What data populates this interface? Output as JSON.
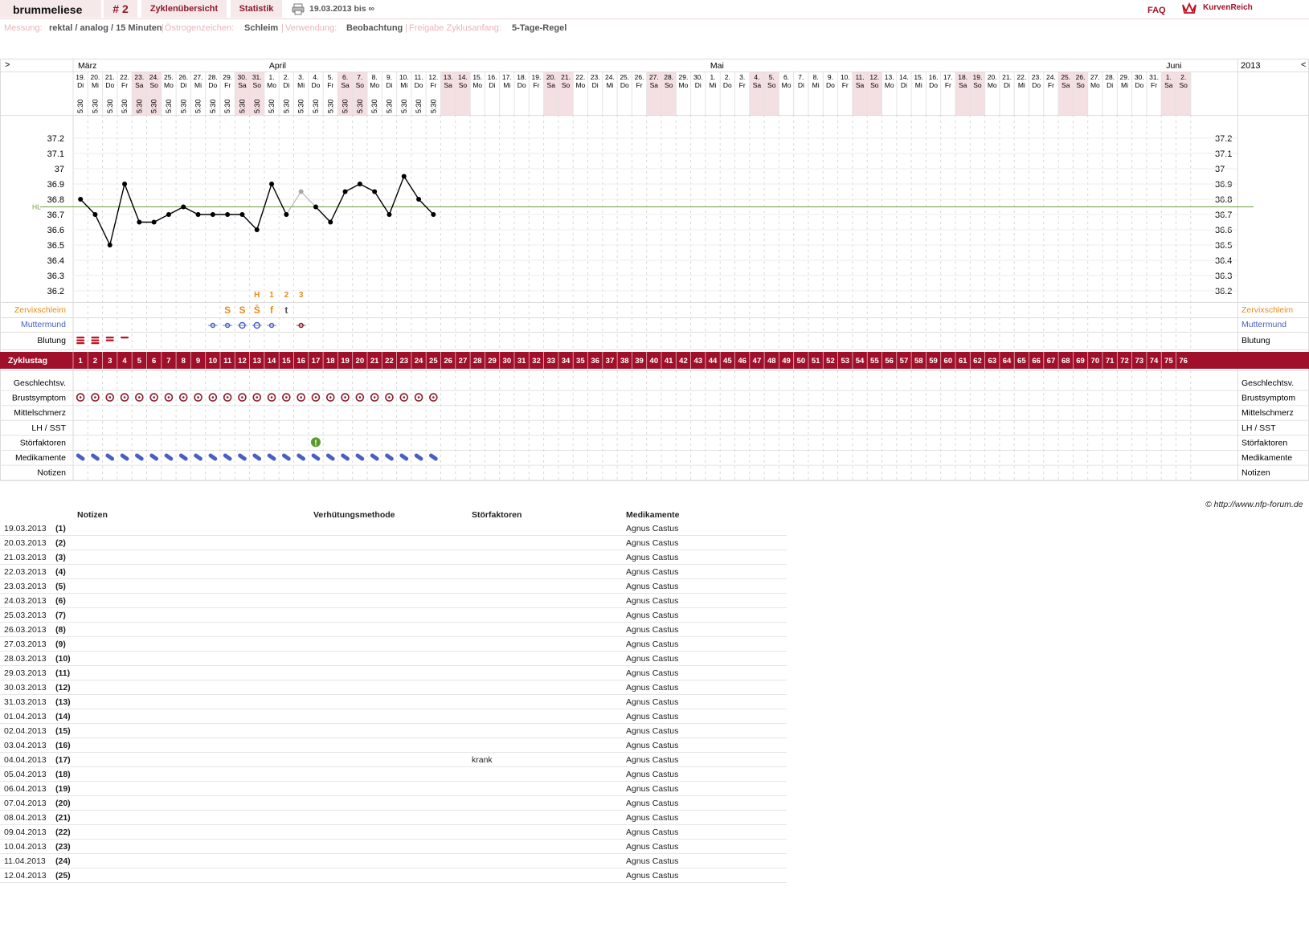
{
  "header": {
    "title": "brummeliese",
    "cycle_number": "# 2",
    "tab_overview": "Zyklenübersicht",
    "tab_stats": "Statistik",
    "date_range": "19.03.2013 bis ∞",
    "faq": "FAQ",
    "logo_text": "KurvenReich"
  },
  "settings": [
    {
      "key": "Messung:",
      "value": "rektal / analog / 15 Minuten"
    },
    {
      "key": "Östrogenzeichen:",
      "value": "Schleim"
    },
    {
      "key": "Verwendung:",
      "value": "Beobachtung"
    },
    {
      "key": "Freigabe Zyklusanfang:",
      "value": "5-Tage-Regel"
    }
  ],
  "nav": {
    "prev": ">",
    "next": "<",
    "year": "2013"
  },
  "months": [
    {
      "label": "März",
      "day_index": 0
    },
    {
      "label": "April",
      "day_index": 13
    },
    {
      "label": "Mai",
      "day_index": 43
    },
    {
      "label": "Juni",
      "day_index": 74
    }
  ],
  "days": [
    [
      "19.",
      "Di"
    ],
    [
      "20.",
      "Mi"
    ],
    [
      "21.",
      "Do"
    ],
    [
      "22.",
      "Fr"
    ],
    [
      "23.",
      "Sa"
    ],
    [
      "24.",
      "So"
    ],
    [
      "25.",
      "Mo"
    ],
    [
      "26.",
      "Di"
    ],
    [
      "27.",
      "Mi"
    ],
    [
      "28.",
      "Do"
    ],
    [
      "29.",
      "Fr"
    ],
    [
      "30.",
      "Sa"
    ],
    [
      "31.",
      "So"
    ],
    [
      "1.",
      "Mo"
    ],
    [
      "2.",
      "Di"
    ],
    [
      "3.",
      "Mi"
    ],
    [
      "4.",
      "Do"
    ],
    [
      "5.",
      "Fr"
    ],
    [
      "6.",
      "Sa"
    ],
    [
      "7.",
      "So"
    ],
    [
      "8.",
      "Mo"
    ],
    [
      "9.",
      "Di"
    ],
    [
      "10.",
      "Mi"
    ],
    [
      "11.",
      "Do"
    ],
    [
      "12.",
      "Fr"
    ],
    [
      "13.",
      "Sa"
    ],
    [
      "14.",
      "So"
    ],
    [
      "15.",
      "Mo"
    ],
    [
      "16.",
      "Di"
    ],
    [
      "17.",
      "Mi"
    ],
    [
      "18.",
      "Do"
    ],
    [
      "19.",
      "Fr"
    ],
    [
      "20.",
      "Sa"
    ],
    [
      "21.",
      "So"
    ],
    [
      "22.",
      "Mo"
    ],
    [
      "23.",
      "Di"
    ],
    [
      "24.",
      "Mi"
    ],
    [
      "25.",
      "Do"
    ],
    [
      "26.",
      "Fr"
    ],
    [
      "27.",
      "Sa"
    ],
    [
      "28.",
      "So"
    ],
    [
      "29.",
      "Mo"
    ],
    [
      "30.",
      "Di"
    ],
    [
      "1.",
      "Mi"
    ],
    [
      "2.",
      "Do"
    ],
    [
      "3.",
      "Fr"
    ],
    [
      "4.",
      "Sa"
    ],
    [
      "5.",
      "So"
    ],
    [
      "6.",
      "Mo"
    ],
    [
      "7.",
      "Di"
    ],
    [
      "8.",
      "Mi"
    ],
    [
      "9.",
      "Do"
    ],
    [
      "10.",
      "Fr"
    ],
    [
      "11.",
      "Sa"
    ],
    [
      "12.",
      "So"
    ],
    [
      "13.",
      "Mo"
    ],
    [
      "14.",
      "Di"
    ],
    [
      "15.",
      "Mi"
    ],
    [
      "16.",
      "Do"
    ],
    [
      "17.",
      "Fr"
    ],
    [
      "18.",
      "Sa"
    ],
    [
      "19.",
      "So"
    ],
    [
      "20.",
      "Mo"
    ],
    [
      "21.",
      "Di"
    ],
    [
      "22.",
      "Mi"
    ],
    [
      "23.",
      "Do"
    ],
    [
      "24.",
      "Fr"
    ],
    [
      "25.",
      "Sa"
    ],
    [
      "26.",
      "So"
    ],
    [
      "27.",
      "Mo"
    ],
    [
      "28.",
      "Di"
    ],
    [
      "29.",
      "Mi"
    ],
    [
      "30.",
      "Do"
    ],
    [
      "31.",
      "Fr"
    ],
    [
      "1.",
      "Sa"
    ],
    [
      "2.",
      "So"
    ]
  ],
  "weekend_indices": [
    4,
    5,
    11,
    12,
    18,
    19,
    25,
    26,
    32,
    33,
    39,
    40,
    46,
    47,
    53,
    54,
    60,
    61,
    67,
    68,
    74,
    75
  ],
  "measure_time": "5:30",
  "measured_days": 25,
  "y_ticks": [
    "37.2",
    "37.1",
    "37",
    "36.9",
    "36.8",
    "36.7",
    "36.6",
    "36.5",
    "36.4",
    "36.3",
    "36.2"
  ],
  "hl_label": "HL",
  "chart_data": {
    "type": "line",
    "ylim": [
      36.1,
      37.3
    ],
    "coverline": 36.75,
    "values": [
      36.8,
      36.7,
      36.5,
      36.9,
      36.65,
      36.65,
      36.7,
      36.75,
      36.7,
      36.7,
      36.7,
      36.7,
      36.6,
      36.9,
      36.7,
      36.85,
      36.75,
      36.65,
      36.85,
      36.9,
      36.85,
      36.7,
      36.95,
      36.8,
      36.7
    ],
    "excluded_indices": [
      15
    ]
  },
  "peak_markers": [
    {
      "day": 12,
      "label": "H"
    },
    {
      "day": 13,
      "label": "1"
    },
    {
      "day": 14,
      "label": "2"
    },
    {
      "day": 15,
      "label": "3"
    }
  ],
  "mucus": [
    {
      "day": 10,
      "label": "S"
    },
    {
      "day": 11,
      "label": "S"
    },
    {
      "day": 12,
      "label": "S̄"
    },
    {
      "day": 13,
      "label": "f"
    },
    {
      "day": 14,
      "label": "t"
    }
  ],
  "cervix_days": [
    9,
    10,
    11,
    12,
    13,
    15
  ],
  "bleeding": [
    3,
    3,
    2,
    1
  ],
  "row_labels_top": {
    "zervix": "Zervixschleim",
    "muttermund": "Muttermund",
    "blutung": "Blutung"
  },
  "cycle_day_label": "Zyklustag",
  "cycle_days": [
    "1",
    "2",
    "3",
    "4",
    "5",
    "6",
    "7",
    "8",
    "9",
    "10",
    "11",
    "12",
    "13",
    "14",
    "15",
    "16",
    "17",
    "18",
    "19",
    "20",
    "21",
    "22",
    "23",
    "24",
    "25",
    "26",
    "27",
    "28",
    "29",
    "30",
    "31",
    "32",
    "33",
    "34",
    "35",
    "36",
    "37",
    "38",
    "39",
    "40",
    "41",
    "42",
    "43",
    "44",
    "45",
    "46",
    "47",
    "48",
    "49",
    "50",
    "51",
    "52",
    "53",
    "54",
    "55",
    "56",
    "57",
    "58",
    "59",
    "60",
    "61",
    "62",
    "63",
    "64",
    "65",
    "66",
    "67",
    "68",
    "69",
    "70",
    "71",
    "72",
    "73",
    "74",
    "75",
    "76"
  ],
  "row_labels_bottom": [
    "Geschlechtsv.",
    "Brustsymptom",
    "Mittelschmerz",
    "LH / SST",
    "Störfaktoren",
    "Medikamente",
    "Notizen"
  ],
  "stoerfaktor_day": 16,
  "copyright": "© http://www.nfp-forum.de",
  "notes_table": {
    "headers": [
      "Notizen",
      "Verhütungsmethode",
      "Störfaktoren",
      "Medikamente"
    ],
    "rows": [
      {
        "date": "19.03.2013",
        "day": "(1)",
        "stoer": "",
        "med": "Agnus Castus"
      },
      {
        "date": "20.03.2013",
        "day": "(2)",
        "stoer": "",
        "med": "Agnus Castus"
      },
      {
        "date": "21.03.2013",
        "day": "(3)",
        "stoer": "",
        "med": "Agnus Castus"
      },
      {
        "date": "22.03.2013",
        "day": "(4)",
        "stoer": "",
        "med": "Agnus Castus"
      },
      {
        "date": "23.03.2013",
        "day": "(5)",
        "stoer": "",
        "med": "Agnus Castus"
      },
      {
        "date": "24.03.2013",
        "day": "(6)",
        "stoer": "",
        "med": "Agnus Castus"
      },
      {
        "date": "25.03.2013",
        "day": "(7)",
        "stoer": "",
        "med": "Agnus Castus"
      },
      {
        "date": "26.03.2013",
        "day": "(8)",
        "stoer": "",
        "med": "Agnus Castus"
      },
      {
        "date": "27.03.2013",
        "day": "(9)",
        "stoer": "",
        "med": "Agnus Castus"
      },
      {
        "date": "28.03.2013",
        "day": "(10)",
        "stoer": "",
        "med": "Agnus Castus"
      },
      {
        "date": "29.03.2013",
        "day": "(11)",
        "stoer": "",
        "med": "Agnus Castus"
      },
      {
        "date": "30.03.2013",
        "day": "(12)",
        "stoer": "",
        "med": "Agnus Castus"
      },
      {
        "date": "31.03.2013",
        "day": "(13)",
        "stoer": "",
        "med": "Agnus Castus"
      },
      {
        "date": "01.04.2013",
        "day": "(14)",
        "stoer": "",
        "med": "Agnus Castus"
      },
      {
        "date": "02.04.2013",
        "day": "(15)",
        "stoer": "",
        "med": "Agnus Castus"
      },
      {
        "date": "03.04.2013",
        "day": "(16)",
        "stoer": "",
        "med": "Agnus Castus"
      },
      {
        "date": "04.04.2013",
        "day": "(17)",
        "stoer": "krank",
        "med": "Agnus Castus"
      },
      {
        "date": "05.04.2013",
        "day": "(18)",
        "stoer": "",
        "med": "Agnus Castus"
      },
      {
        "date": "06.04.2013",
        "day": "(19)",
        "stoer": "",
        "med": "Agnus Castus"
      },
      {
        "date": "07.04.2013",
        "day": "(20)",
        "stoer": "",
        "med": "Agnus Castus"
      },
      {
        "date": "08.04.2013",
        "day": "(21)",
        "stoer": "",
        "med": "Agnus Castus"
      },
      {
        "date": "09.04.2013",
        "day": "(22)",
        "stoer": "",
        "med": "Agnus Castus"
      },
      {
        "date": "10.04.2013",
        "day": "(23)",
        "stoer": "",
        "med": "Agnus Castus"
      },
      {
        "date": "11.04.2013",
        "day": "(24)",
        "stoer": "",
        "med": "Agnus Castus"
      },
      {
        "date": "12.04.2013",
        "day": "(25)",
        "stoer": "",
        "med": "Agnus Castus"
      }
    ]
  },
  "colors": {
    "accent": "#a0102a",
    "weekend": "#f4dfe2",
    "grid": "#d7d7d7",
    "temp_line": "#000000",
    "coverline": "#6f9a3f",
    "mucus": "#e88b1a",
    "cervix": "#4a5fc4",
    "pill": "#4a5fc4",
    "bleeding": "#c01020"
  },
  "icons": {
    "print": "printer-icon",
    "logo": "crown-icon",
    "breast": "breast-symptom-icon",
    "pill": "pill-icon",
    "warning": "warning-icon"
  }
}
